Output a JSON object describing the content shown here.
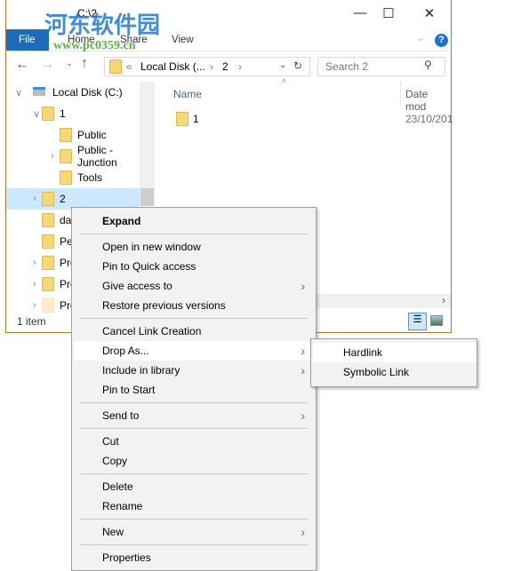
{
  "window": {
    "title": "C:\\2",
    "minimize": "—",
    "maximize": "☐",
    "close": "✕"
  },
  "ribbon": {
    "tabs": [
      "File",
      "Home",
      "Share",
      "View"
    ],
    "help": "?"
  },
  "nav": {
    "address": [
      "«",
      "Local Disk (...",
      "›",
      "2",
      "›"
    ],
    "search_placeholder": "Search 2"
  },
  "tree": [
    {
      "label": "Local Disk (C:)",
      "expand": "down"
    },
    {
      "label": "1",
      "expand": "down"
    },
    {
      "label": "Public"
    },
    {
      "label": "Public - Junction",
      "expand": "right"
    },
    {
      "label": "Tools"
    },
    {
      "label": "2",
      "expand": "right",
      "selected": true
    },
    {
      "label": "da"
    },
    {
      "label": "Pe"
    },
    {
      "label": "Pro",
      "expand": "right"
    },
    {
      "label": "Pro",
      "expand": "right"
    },
    {
      "label": "Pro",
      "expand": "right"
    }
  ],
  "list": {
    "columns": [
      "Name",
      "Date mod"
    ],
    "rows": [
      {
        "name": "1",
        "date": "23/10/201"
      }
    ]
  },
  "status": {
    "count": "1 item"
  },
  "context_menu": {
    "items": [
      "Expand",
      "Open in new window",
      "Pin to Quick access",
      "Give access to",
      "Restore previous versions",
      "Cancel Link Creation",
      "Drop As...",
      "Include in library",
      "Pin to Start",
      "Send to",
      "Cut",
      "Copy",
      "Delete",
      "Rename",
      "New",
      "Properties"
    ]
  },
  "submenu": {
    "items": [
      "Hardlink",
      "Symbolic Link"
    ]
  },
  "watermark": {
    "text": "河东软件园",
    "url": "www.pc0359.cn"
  }
}
